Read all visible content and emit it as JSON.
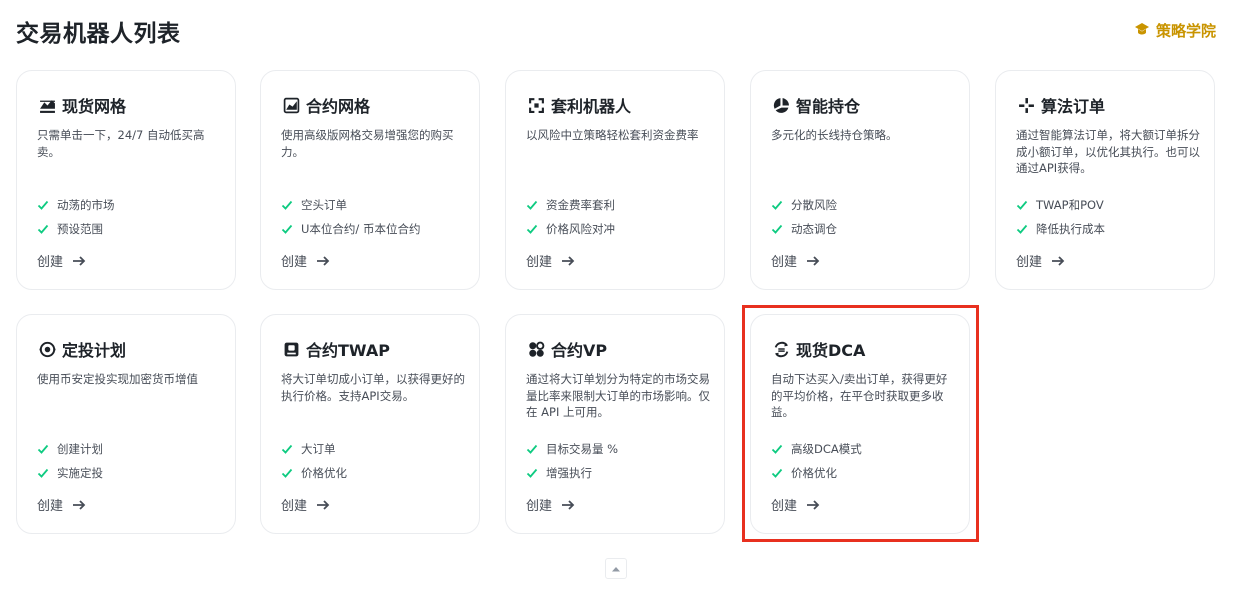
{
  "header": {
    "title": "交易机器人列表",
    "academy_label": "策略学院",
    "academy_icon": "graduation-cap-icon"
  },
  "colors": {
    "accent": "#c99400",
    "check": "#0ecb81",
    "highlight": "#e8301f"
  },
  "cards": [
    {
      "title": "现货网格",
      "icon": "spot-grid-icon",
      "desc": "只需单击一下，24/7 自动低买高卖。",
      "features": [
        "动荡的市场",
        "预设范围"
      ],
      "create": "创建"
    },
    {
      "title": "合约网格",
      "icon": "futures-grid-icon",
      "desc": "使用高级版网格交易增强您的购买力。",
      "features": [
        "空头订单",
        "U本位合约/ 币本位合约"
      ],
      "create": "创建"
    },
    {
      "title": "套利机器人",
      "icon": "arbitrage-icon",
      "desc": "以风险中立策略轻松套利资金费率",
      "features": [
        "资金费率套利",
        "价格风险对冲"
      ],
      "create": "创建"
    },
    {
      "title": "智能持仓",
      "icon": "rebalance-pie-icon",
      "desc": "多元化的长线持仓策略。",
      "features": [
        "分散风险",
        "动态调仓"
      ],
      "create": "创建"
    },
    {
      "title": "算法订单",
      "icon": "algo-order-icon",
      "desc": "通过智能算法订单，将大额订单拆分成小额订单，以优化其执行。也可以通过API获得。",
      "features": [
        "TWAP和POV",
        "降低执行成本"
      ],
      "create": "创建"
    },
    {
      "title": "定投计划",
      "icon": "auto-invest-icon",
      "desc": "使用币安定投实现加密货币增值",
      "features": [
        "创建计划",
        "实施定投"
      ],
      "create": "创建"
    },
    {
      "title": "合约TWAP",
      "icon": "futures-twap-icon",
      "desc": "将大订单切成小订单，以获得更好的执行价格。支持API交易。",
      "features": [
        "大订单",
        "价格优化"
      ],
      "create": "创建"
    },
    {
      "title": "合约VP",
      "icon": "futures-vp-icon",
      "desc": "通过将大订单划分为特定的市场交易量比率来限制大订单的市场影响。仅在 API 上可用。",
      "features": [
        "目标交易量 %",
        "增强执行"
      ],
      "create": "创建"
    },
    {
      "title": "现货DCA",
      "icon": "spot-dca-icon",
      "desc": "自动下达买入/卖出订单，获得更好的平均价格，在平仓时获取更多收益。",
      "features": [
        "高级DCA模式",
        "价格优化"
      ],
      "create": "创建"
    }
  ]
}
